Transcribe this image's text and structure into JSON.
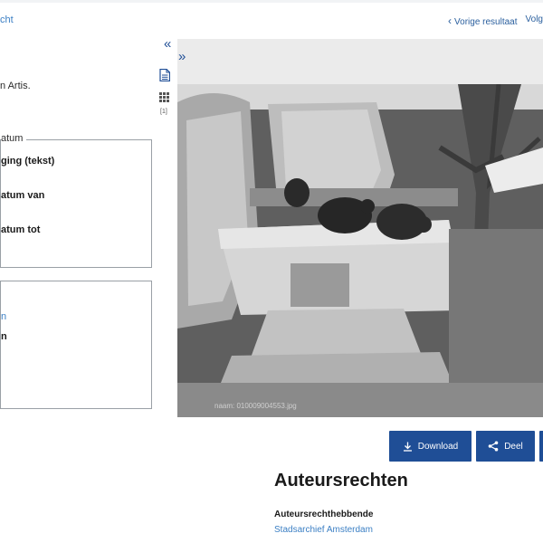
{
  "nav": {
    "back_label": "cht",
    "prev_label": "Vorige resultaat",
    "next_label": "Volg"
  },
  "sidebar": {
    "collapse_glyph": "«",
    "doc_icon": "document-icon",
    "grid_icon": "grid-icon",
    "grid_count": "[1]"
  },
  "description": {
    "text": "n Artis."
  },
  "datum_panel": {
    "legend": "atum",
    "rows": [
      "ging (tekst)",
      "atum van",
      "atum tot"
    ]
  },
  "second_panel": {
    "link": "n",
    "bold": "n"
  },
  "viewer": {
    "expand_glyph": "»",
    "filename": "naam: 010009004553.jpg"
  },
  "actions": {
    "download_label": "Download",
    "share_label": "Deel"
  },
  "rights": {
    "title": "Auteursrechten",
    "holder_label": "Auteursrechthebbende",
    "holder_value": "Stadsarchief Amsterdam"
  },
  "colors": {
    "accent": "#1f4e96",
    "link": "#3b7fc4"
  }
}
